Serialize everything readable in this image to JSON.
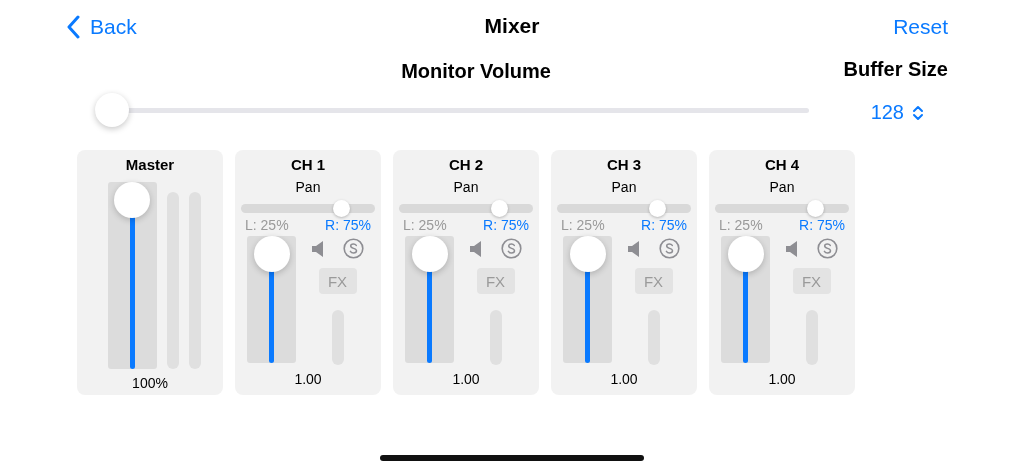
{
  "nav": {
    "back": "Back",
    "title": "Mixer",
    "reset": "Reset"
  },
  "monitor": {
    "label": "Monitor Volume",
    "level": 0
  },
  "buffer": {
    "label": "Buffer Size",
    "value": "128"
  },
  "master": {
    "name": "Master",
    "level": 1,
    "reading": "100%"
  },
  "channels": [
    {
      "name": "CH 1",
      "pan_label": "Pan",
      "pan_slider": {
        "level": 0.75
      },
      "left": "L: 25%",
      "right": "R: 75%",
      "level": 1,
      "reading": "1.00",
      "fx": "FX",
      "fx_disabled": true
    },
    {
      "name": "CH 2",
      "pan_label": "Pan",
      "pan_slider": {
        "level": 0.75
      },
      "left": "L: 25%",
      "right": "R: 75%",
      "level": 1,
      "reading": "1.00",
      "fx": "FX",
      "fx_disabled": true
    },
    {
      "name": "CH 3",
      "pan_label": "Pan",
      "pan_slider": {
        "level": 0.75
      },
      "left": "L: 25%",
      "right": "R: 75%",
      "level": 1,
      "reading": "1.00",
      "fx": "FX",
      "fx_disabled": true
    },
    {
      "name": "CH 4",
      "pan_label": "Pan",
      "pan_slider": {
        "level": 0.75
      },
      "left": "L: 25%",
      "right": "R: 75%",
      "level": 1,
      "reading": "1.00",
      "fx": "FX",
      "fx_disabled": true
    }
  ]
}
